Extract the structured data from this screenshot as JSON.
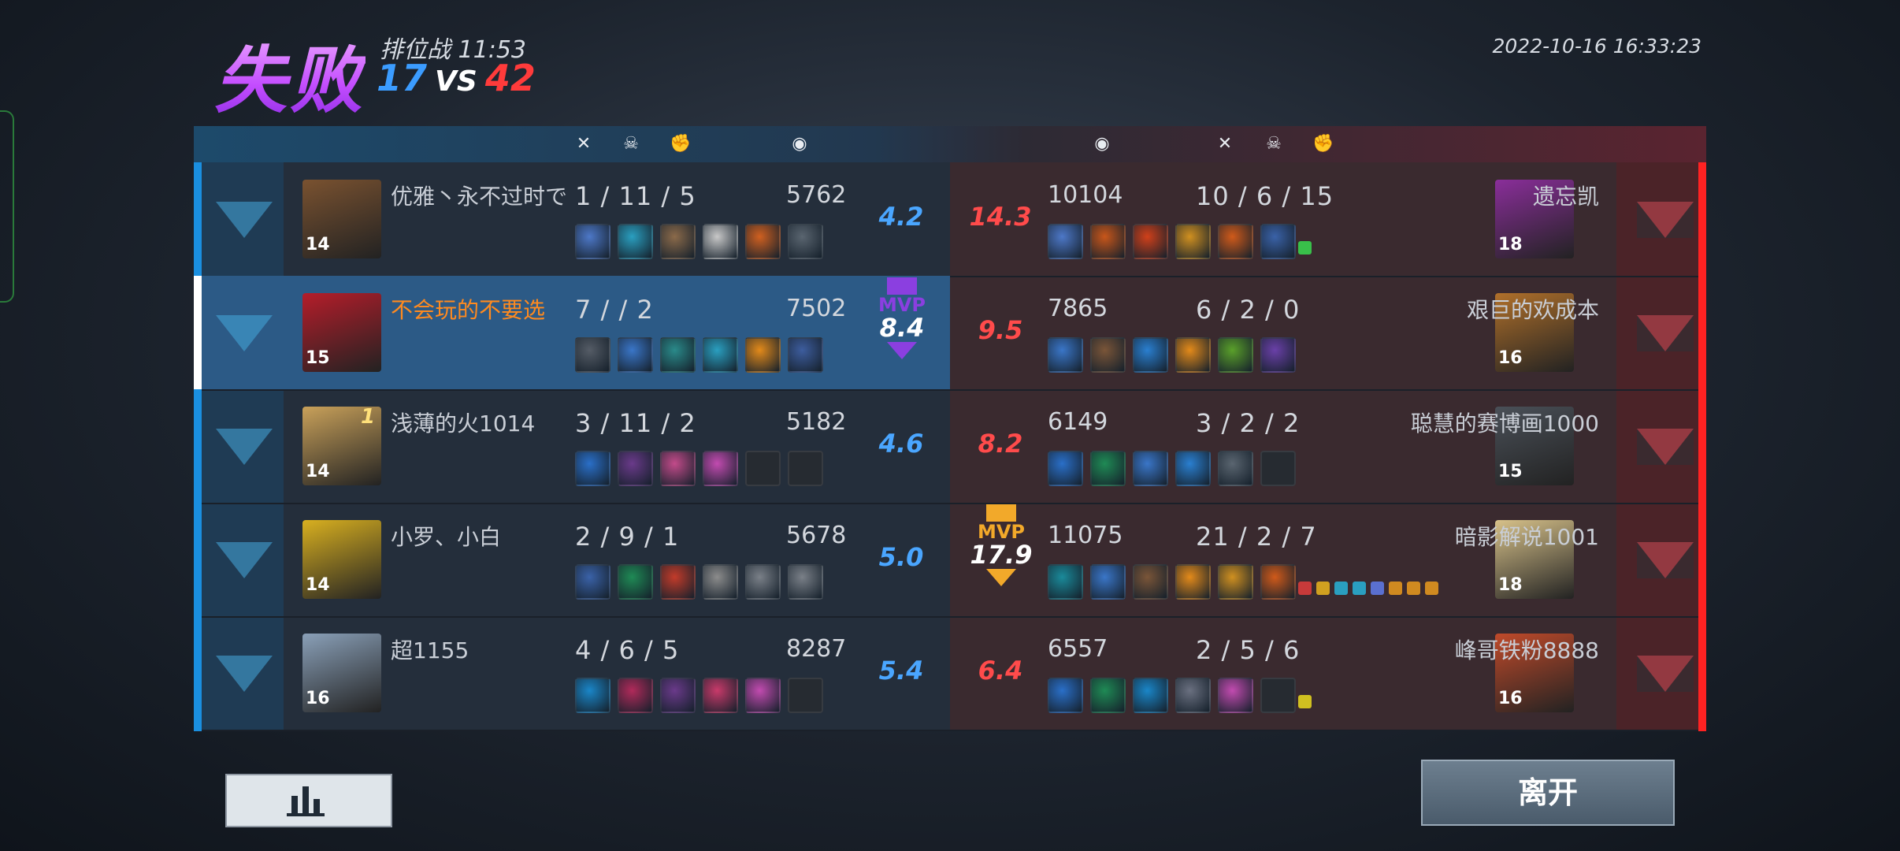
{
  "header": {
    "result": "失败",
    "mode": "排位战",
    "duration": "11:53",
    "score_blue": "17",
    "score_vs": "VS",
    "score_red": "42",
    "datetime": "2022-10-16  16:33:23"
  },
  "column_icons": {
    "kills": "crossed-swords-icon",
    "deaths": "skull-icon",
    "assists": "fist-icon",
    "gold": "coin-icon"
  },
  "colors": {
    "blue": "#1a8fe0",
    "red": "#ff2222",
    "mvp_purple": "#8b3fe0",
    "mvp_gold": "#f2a92a",
    "me": "#ff8a1f"
  },
  "blue_team": [
    {
      "name": "优雅丶永不过时で",
      "level": "14",
      "k": "1",
      "d": "11",
      "a": "5",
      "gold": "5762",
      "rating": "4.2",
      "portrait": "#7a5230",
      "items": [
        "#4d78c8",
        "#2a9fc0",
        "#8b6a4a",
        "#c8c8c8",
        "#d06020",
        "#5a6570"
      ]
    },
    {
      "name": "不会玩的不要选",
      "level": "15",
      "k": "7",
      "d": "",
      "a": "2",
      "gold": "7502",
      "rating": "8.4",
      "mvp": "MVP",
      "me": true,
      "portrait": "#b51d2a",
      "items": [
        "#555c66",
        "#3a76c8",
        "#2a8a8a",
        "#2a9fc0",
        "#e38a1a",
        "#3d5d9e"
      ]
    },
    {
      "name": "浅薄的火1014",
      "level": "14",
      "rank": "1",
      "k": "3",
      "d": "11",
      "a": "2",
      "gold": "5182",
      "rating": "4.6",
      "portrait": "#c9a15a",
      "items": [
        "#2a6fc8",
        "#6a3a8a",
        "#c24b8a",
        "#c24bb0",
        "",
        ""
      ]
    },
    {
      "name": "小罗、小白",
      "level": "14",
      "k": "2",
      "d": "9",
      "a": "1",
      "gold": "5678",
      "rating": "5.0",
      "portrait": "#d9b020",
      "items": [
        "#3a62a8",
        "#1f8a55",
        "#c23b2a",
        "#8c8c8c",
        "#7a8088",
        "#7a8088"
      ]
    },
    {
      "name": "超1155",
      "level": "16",
      "k": "4",
      "d": "6",
      "a": "5",
      "gold": "8287",
      "rating": "5.4",
      "portrait": "#8aa0b8",
      "items": [
        "#1a86c8",
        "#b02a5a",
        "#6a3a8a",
        "#c83a6a",
        "#c24bb0",
        ""
      ]
    }
  ],
  "red_team": [
    {
      "name": "遗忘凯",
      "level": "18",
      "k": "10",
      "d": "6",
      "a": "15",
      "gold": "10104",
      "rating": "14.3",
      "portrait": "#8a2e9a",
      "items": [
        "#4d78c8",
        "#c8561a",
        "#d0401a",
        "#d09020",
        "#d05a1a",
        "#3a62a8"
      ],
      "badges": [
        "#39c04a"
      ]
    },
    {
      "name": "艰巨的欢成本",
      "level": "16",
      "k": "6",
      "d": "2",
      "a": "0",
      "gold": "7865",
      "rating": "9.5",
      "portrait": "#b0702a",
      "items": [
        "#3a76c8",
        "#7a5538",
        "#2a7fd0",
        "#e38a1a",
        "#5aa02a",
        "#6a40a8"
      ]
    },
    {
      "name": "聪慧的赛博画1000",
      "level": "15",
      "k": "3",
      "d": "2",
      "a": "2",
      "gold": "6149",
      "rating": "8.2",
      "portrait": "#4a5058",
      "items": [
        "#2a6fc8",
        "#1f8a55",
        "#3a76c8",
        "#2a7fd0",
        "#5a6570",
        ""
      ]
    },
    {
      "name": "暗影解说1001",
      "level": "18",
      "k": "21",
      "d": "2",
      "a": "7",
      "gold": "11075",
      "rating": "17.9",
      "mvp": "MVP",
      "portrait": "#d8c28a",
      "items": [
        "#1a8a9a",
        "#3a76c8",
        "#7a5538",
        "#e38a1a",
        "#d09020",
        "#d05a1a"
      ],
      "badges": [
        "#c83a3a",
        "#d0a020",
        "#2a9fc0",
        "#2a9fc0",
        "#5a70d0",
        "#d08a20",
        "#d08a20",
        "#d08a20"
      ]
    },
    {
      "name": "峰哥铁粉8888",
      "level": "16",
      "k": "2",
      "d": "5",
      "a": "6",
      "gold": "6557",
      "rating": "6.4",
      "portrait": "#c04a2a",
      "items": [
        "#2a6fc8",
        "#1f8a55",
        "#1a86c8",
        "#6a7080",
        "#c24bb0",
        ""
      ],
      "badges": [
        "#d0c020"
      ]
    }
  ],
  "buttons": {
    "stats": "bar-chart-icon",
    "leave": "离开"
  }
}
